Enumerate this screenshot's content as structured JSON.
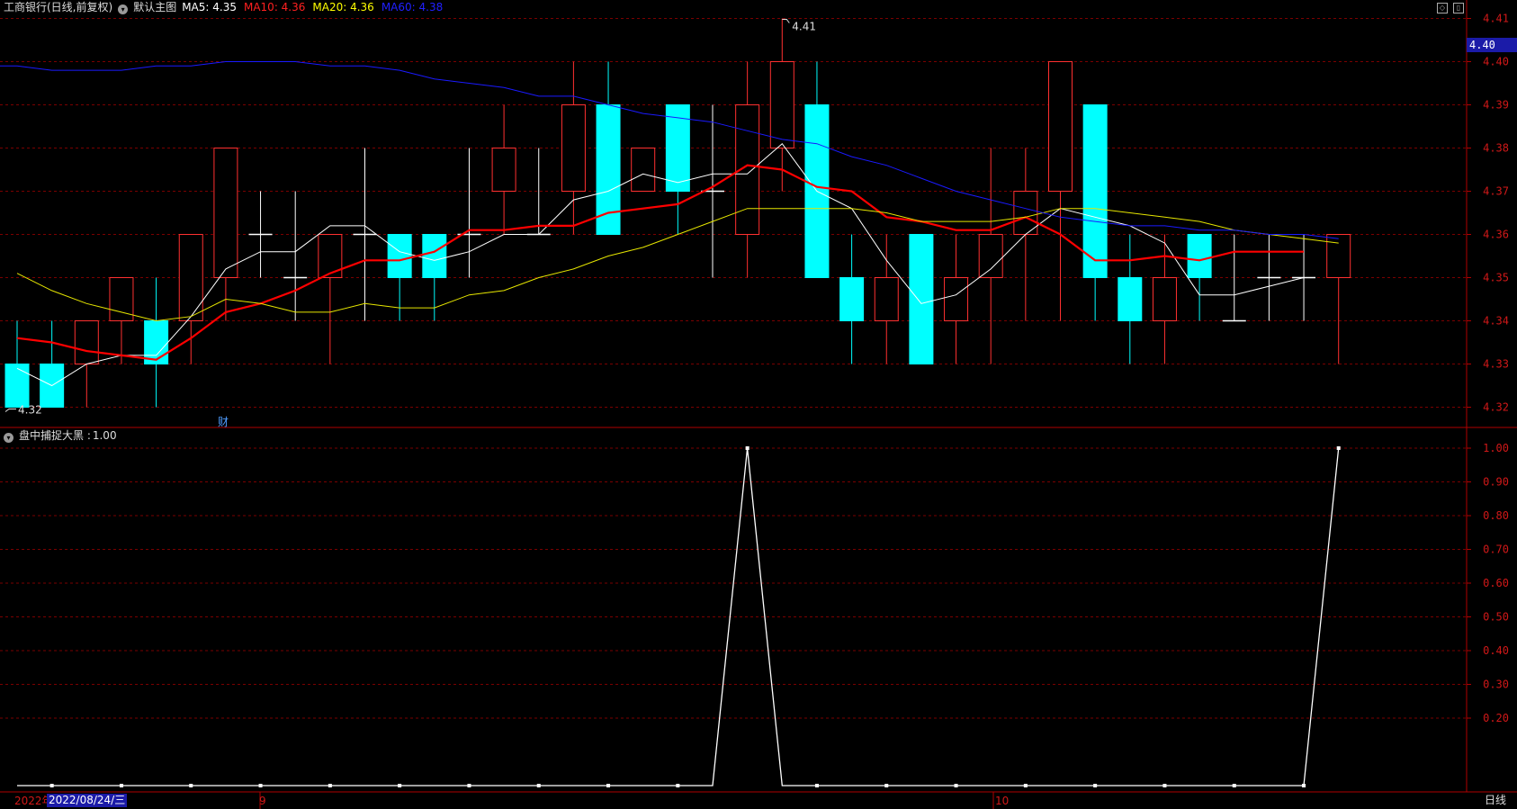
{
  "header": {
    "title": "工商银行(日线,前复权)",
    "template": "默认主图",
    "ma": [
      {
        "label": "MA5:",
        "value": "4.35",
        "color": "#ffffff"
      },
      {
        "label": "MA10:",
        "value": "4.36",
        "color": "#ff2020"
      },
      {
        "label": "MA20:",
        "value": "4.36",
        "color": "#ffff00"
      },
      {
        "label": "MA60:",
        "value": "4.38",
        "color": "#2020ff"
      }
    ]
  },
  "sub_header": {
    "title": "盘中捕捉大黑 :",
    "value": "1.00"
  },
  "current_price": "4.40",
  "annotations": {
    "high": "4.41",
    "low": "4.32",
    "fin_marker": "财"
  },
  "bottom": {
    "start_label": "2022年",
    "cursor_date": "2022/08/24/三",
    "month_9": "9",
    "month_10": "10",
    "period": "日线"
  },
  "colors": {
    "up": "#ff3030",
    "down": "#00ffff",
    "ma5": "#ffffff",
    "ma10": "#ff0000",
    "ma20": "#e6e600",
    "ma60": "#1a1aff",
    "axis": "#b00000",
    "grid": "#7a0000"
  },
  "chart_data": [
    {
      "type": "candlestick",
      "y_ticks": [
        "4.32",
        "4.33",
        "4.34",
        "4.35",
        "4.36",
        "4.37",
        "4.38",
        "4.39",
        "4.40",
        "4.41"
      ],
      "ylim": [
        4.318,
        4.415
      ],
      "candles": [
        {
          "o": 4.33,
          "h": 4.34,
          "l": 4.32,
          "c": 4.32
        },
        {
          "o": 4.33,
          "h": 4.34,
          "l": 4.32,
          "c": 4.32
        },
        {
          "o": 4.33,
          "h": 4.34,
          "l": 4.32,
          "c": 4.34
        },
        {
          "o": 4.34,
          "h": 4.35,
          "l": 4.33,
          "c": 4.35
        },
        {
          "o": 4.34,
          "h": 4.35,
          "l": 4.32,
          "c": 4.33
        },
        {
          "o": 4.34,
          "h": 4.36,
          "l": 4.33,
          "c": 4.36
        },
        {
          "o": 4.35,
          "h": 4.38,
          "l": 4.34,
          "c": 4.38
        },
        {
          "o": 4.36,
          "h": 4.37,
          "l": 4.35,
          "c": 4.36
        },
        {
          "o": 4.35,
          "h": 4.37,
          "l": 4.34,
          "c": 4.35
        },
        {
          "o": 4.35,
          "h": 4.36,
          "l": 4.33,
          "c": 4.36
        },
        {
          "o": 4.36,
          "h": 4.38,
          "l": 4.34,
          "c": 4.36
        },
        {
          "o": 4.36,
          "h": 4.36,
          "l": 4.34,
          "c": 4.35
        },
        {
          "o": 4.36,
          "h": 4.36,
          "l": 4.34,
          "c": 4.35
        },
        {
          "o": 4.36,
          "h": 4.38,
          "l": 4.35,
          "c": 4.36
        },
        {
          "o": 4.37,
          "h": 4.39,
          "l": 4.36,
          "c": 4.38
        },
        {
          "o": 4.36,
          "h": 4.38,
          "l": 4.36,
          "c": 4.36
        },
        {
          "o": 4.37,
          "h": 4.4,
          "l": 4.36,
          "c": 4.39
        },
        {
          "o": 4.39,
          "h": 4.4,
          "l": 4.36,
          "c": 4.36
        },
        {
          "o": 4.37,
          "h": 4.38,
          "l": 4.37,
          "c": 4.38
        },
        {
          "o": 4.39,
          "h": 4.39,
          "l": 4.36,
          "c": 4.37
        },
        {
          "o": 4.37,
          "h": 4.39,
          "l": 4.35,
          "c": 4.37
        },
        {
          "o": 4.36,
          "h": 4.4,
          "l": 4.35,
          "c": 4.39
        },
        {
          "o": 4.38,
          "h": 4.41,
          "l": 4.37,
          "c": 4.4
        },
        {
          "o": 4.39,
          "h": 4.4,
          "l": 4.35,
          "c": 4.35
        },
        {
          "o": 4.35,
          "h": 4.36,
          "l": 4.33,
          "c": 4.34
        },
        {
          "o": 4.34,
          "h": 4.36,
          "l": 4.33,
          "c": 4.35
        },
        {
          "o": 4.36,
          "h": 4.36,
          "l": 4.33,
          "c": 4.33
        },
        {
          "o": 4.34,
          "h": 4.36,
          "l": 4.33,
          "c": 4.35
        },
        {
          "o": 4.35,
          "h": 4.38,
          "l": 4.33,
          "c": 4.36
        },
        {
          "o": 4.36,
          "h": 4.38,
          "l": 4.34,
          "c": 4.37
        },
        {
          "o": 4.37,
          "h": 4.4,
          "l": 4.34,
          "c": 4.4
        },
        {
          "o": 4.39,
          "h": 4.39,
          "l": 4.34,
          "c": 4.35
        },
        {
          "o": 4.35,
          "h": 4.36,
          "l": 4.33,
          "c": 4.34
        },
        {
          "o": 4.34,
          "h": 4.36,
          "l": 4.33,
          "c": 4.35
        },
        {
          "o": 4.36,
          "h": 4.36,
          "l": 4.34,
          "c": 4.35
        },
        {
          "o": 4.34,
          "h": 4.36,
          "l": 4.34,
          "c": 4.34
        },
        {
          "o": 4.35,
          "h": 4.36,
          "l": 4.34,
          "c": 4.35
        },
        {
          "o": 4.35,
          "h": 4.36,
          "l": 4.34,
          "c": 4.35
        },
        {
          "o": 4.35,
          "h": 4.36,
          "l": 4.33,
          "c": 4.36
        }
      ],
      "series": [
        {
          "name": "MA5",
          "values": [
            4.329,
            4.325,
            4.33,
            4.332,
            4.332,
            4.341,
            4.352,
            4.356,
            4.356,
            4.362,
            4.362,
            4.356,
            4.354,
            4.356,
            4.36,
            4.36,
            4.368,
            4.37,
            4.374,
            4.372,
            4.374,
            4.374,
            4.381,
            4.37,
            4.366,
            4.354,
            4.344,
            4.346,
            4.352,
            4.36,
            4.366,
            4.364,
            4.362,
            4.358,
            4.346,
            4.346,
            4.348,
            4.35,
            null
          ]
        },
        {
          "name": "MA10",
          "values": [
            4.336,
            4.335,
            4.333,
            4.332,
            4.331,
            4.336,
            4.342,
            4.344,
            4.347,
            4.351,
            4.354,
            4.354,
            4.356,
            4.361,
            4.361,
            4.362,
            4.362,
            4.365,
            4.366,
            4.367,
            4.371,
            4.376,
            4.375,
            4.371,
            4.37,
            4.364,
            4.363,
            4.361,
            4.361,
            4.364,
            4.36,
            4.354,
            4.354,
            4.355,
            4.354,
            4.356,
            4.356,
            4.356,
            null
          ]
        },
        {
          "name": "MA20",
          "values": [
            4.351,
            4.347,
            4.344,
            4.342,
            4.34,
            4.341,
            4.345,
            4.344,
            4.342,
            4.342,
            4.344,
            4.343,
            4.343,
            4.346,
            4.347,
            4.35,
            4.352,
            4.355,
            4.357,
            4.36,
            4.363,
            4.366,
            4.366,
            4.366,
            4.366,
            4.365,
            4.363,
            4.363,
            4.363,
            4.364,
            4.366,
            4.366,
            4.365,
            4.364,
            4.363,
            4.361,
            4.36,
            4.359,
            4.358
          ]
        },
        {
          "name": "MA60",
          "values": [
            4.399,
            4.398,
            4.398,
            4.398,
            4.399,
            4.399,
            4.4,
            4.4,
            4.4,
            4.399,
            4.399,
            4.398,
            4.396,
            4.395,
            4.394,
            4.392,
            4.392,
            4.39,
            4.388,
            4.387,
            4.386,
            4.384,
            4.382,
            4.381,
            4.378,
            4.376,
            4.373,
            4.37,
            4.368,
            4.366,
            4.364,
            4.363,
            4.362,
            4.362,
            4.361,
            4.361,
            4.36,
            4.36,
            4.359
          ]
        }
      ]
    },
    {
      "type": "line",
      "name": "盘中捕捉大黑",
      "y_ticks": [
        "0.20",
        "0.30",
        "0.40",
        "0.50",
        "0.60",
        "0.70",
        "0.80",
        "0.90",
        "1.00"
      ],
      "ylim": [
        0,
        1
      ],
      "values": [
        0,
        0,
        0,
        0,
        0,
        0,
        0,
        0,
        0,
        0,
        0,
        0,
        0,
        0,
        0,
        0,
        0,
        0,
        0,
        0,
        0,
        1,
        0,
        0,
        0,
        0,
        0,
        0,
        0,
        0,
        0,
        0,
        0,
        0,
        0,
        0,
        0,
        0,
        1
      ]
    }
  ]
}
